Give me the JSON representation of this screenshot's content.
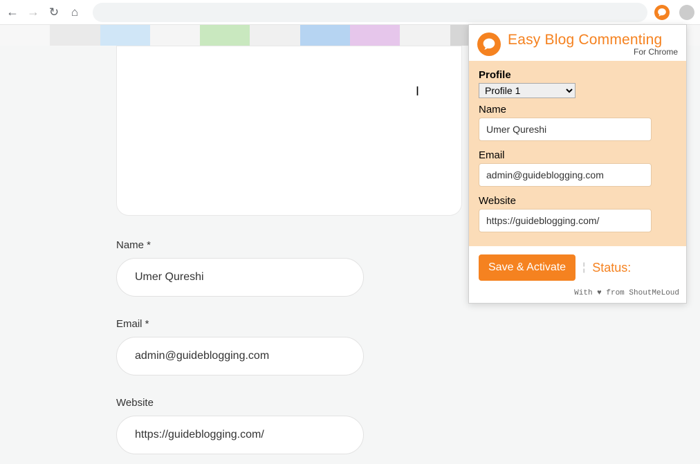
{
  "browser": {
    "back": "←",
    "forward": "→",
    "reload": "↻",
    "home": "⌂"
  },
  "page_form": {
    "name_label": "Name *",
    "name_value": "Umer Qureshi",
    "email_label": "Email *",
    "email_value": "admin@guideblogging.com",
    "website_label": "Website",
    "website_value": "https://guideblogging.com/"
  },
  "popup": {
    "title": "Easy Blog Commenting",
    "subtitle": "For Chrome",
    "profile_label": "Profile",
    "profile_selected": "Profile 1",
    "name_label": "Name",
    "name_value": "Umer Qureshi",
    "email_label": "Email",
    "email_value": "admin@guideblogging.com",
    "website_label": "Website",
    "website_value": "https://guideblogging.com/",
    "save_label": "Save & Activate",
    "status_label": "Status:",
    "credit": "With ♥ from ShoutMeLoud"
  },
  "colors": {
    "accent": "#f58220",
    "popup_bg": "#fbdcb8"
  }
}
